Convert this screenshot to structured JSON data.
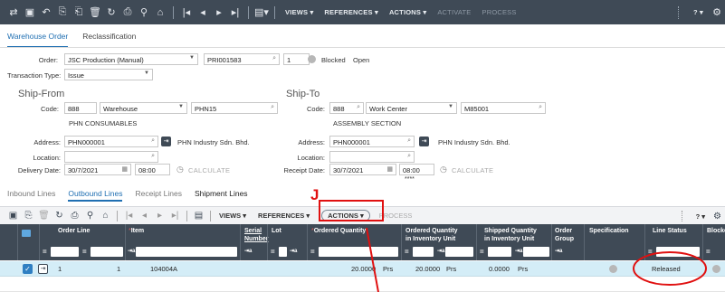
{
  "toolbar": {
    "icons": [
      "navigator-icon",
      "save-icon",
      "undo-icon",
      "copy-icon",
      "paste-icon",
      "delete-icon",
      "refresh-icon",
      "print-icon",
      "search-icon",
      "attach-icon",
      "first-icon",
      "prev-icon",
      "next-icon",
      "last-icon",
      "record-icon"
    ],
    "views": "VIEWS ▾",
    "references": "REFERENCES ▾",
    "actions": "ACTIONS ▾",
    "activate": "ACTIVATE",
    "process": "PROCESS",
    "help": "? ▾",
    "settings_icon": "gear-icon"
  },
  "tabs": {
    "warehouse_order": "Warehouse Order",
    "reclassification": "Reclassification"
  },
  "order": {
    "label": "Order:",
    "type": "JSC Production (Manual)",
    "number": "PRI001583",
    "seq": "1",
    "blocked_label": "Blocked",
    "status": "Open"
  },
  "transaction_type": {
    "label": "Transaction Type:",
    "value": "Issue"
  },
  "ship_from": {
    "title": "Ship-From",
    "code_label": "Code:",
    "code": "888",
    "kind": "Warehouse",
    "id": "PHN15",
    "desc": "PHN CONSUMABLES",
    "address_label": "Address:",
    "address": "PHN000001",
    "company": "PHN Industry Sdn. Bhd.",
    "location_label": "Location:",
    "date_label": "Delivery Date:",
    "date": "30/7/2021",
    "time": "08:00",
    "calc": "CALCULATE"
  },
  "ship_to": {
    "title": "Ship-To",
    "code_label": "Code:",
    "code": "888",
    "kind": "Work Center",
    "id": "M85001",
    "desc": "ASSEMBLY SECTION",
    "address_label": "Address:",
    "address": "PHN000001",
    "company": "PHN Industry Sdn. Bhd.",
    "location_label": "Location:",
    "date_label": "Receipt Date:",
    "date": "30/7/2021",
    "time": "08:00",
    "calc": "CALCULATE",
    "stars": "****"
  },
  "subtabs": {
    "inbound": "Inbound Lines",
    "outbound": "Outbound Lines",
    "receipt": "Receipt Lines",
    "shipment": "Shipment Lines"
  },
  "grid_toolbar": {
    "views": "VIEWS ▾",
    "references": "REFERENCES ▾",
    "actions": "ACTIONS ▾",
    "process": "PROCESS",
    "help": "? ▾"
  },
  "grid": {
    "headers": {
      "order_line": "Order Line",
      "item": "Item",
      "serial": "Serial\nNumber",
      "lot": "Lot",
      "ordered_qty": "Ordered Quantity",
      "ordered_inv": "Ordered Quantity\nin Inventory Unit",
      "shipped_inv": "Shipped Quantity\nin Inventory Unit",
      "order_group": "Order\nGroup",
      "specification": "Specification",
      "line_status": "Line Status",
      "blocked": "Blocke"
    },
    "row": {
      "order_line": "1",
      "seq": "1",
      "item": "104004A",
      "ordered_qty": "20.0000",
      "ordered_unit": "Prs",
      "inv_qty": "20.0000",
      "inv_unit": "Prs",
      "shipped_qty": "0.0000",
      "shipped_unit": "Prs",
      "line_status": "Released"
    }
  },
  "annotation": {
    "letter": "J",
    "color": "#e01010"
  }
}
